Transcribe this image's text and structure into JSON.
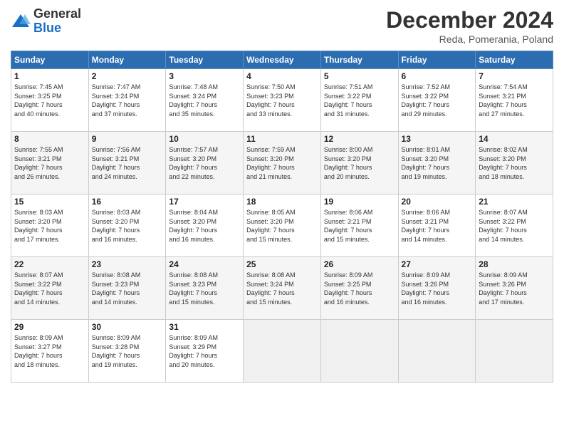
{
  "header": {
    "logo_general": "General",
    "logo_blue": "Blue",
    "month_title": "December 2024",
    "location": "Reda, Pomerania, Poland"
  },
  "weekdays": [
    "Sunday",
    "Monday",
    "Tuesday",
    "Wednesday",
    "Thursday",
    "Friday",
    "Saturday"
  ],
  "weeks": [
    [
      {
        "day": "1",
        "info": "Sunrise: 7:45 AM\nSunset: 3:25 PM\nDaylight: 7 hours\nand 40 minutes."
      },
      {
        "day": "2",
        "info": "Sunrise: 7:47 AM\nSunset: 3:24 PM\nDaylight: 7 hours\nand 37 minutes."
      },
      {
        "day": "3",
        "info": "Sunrise: 7:48 AM\nSunset: 3:24 PM\nDaylight: 7 hours\nand 35 minutes."
      },
      {
        "day": "4",
        "info": "Sunrise: 7:50 AM\nSunset: 3:23 PM\nDaylight: 7 hours\nand 33 minutes."
      },
      {
        "day": "5",
        "info": "Sunrise: 7:51 AM\nSunset: 3:22 PM\nDaylight: 7 hours\nand 31 minutes."
      },
      {
        "day": "6",
        "info": "Sunrise: 7:52 AM\nSunset: 3:22 PM\nDaylight: 7 hours\nand 29 minutes."
      },
      {
        "day": "7",
        "info": "Sunrise: 7:54 AM\nSunset: 3:21 PM\nDaylight: 7 hours\nand 27 minutes."
      }
    ],
    [
      {
        "day": "8",
        "info": "Sunrise: 7:55 AM\nSunset: 3:21 PM\nDaylight: 7 hours\nand 26 minutes."
      },
      {
        "day": "9",
        "info": "Sunrise: 7:56 AM\nSunset: 3:21 PM\nDaylight: 7 hours\nand 24 minutes."
      },
      {
        "day": "10",
        "info": "Sunrise: 7:57 AM\nSunset: 3:20 PM\nDaylight: 7 hours\nand 22 minutes."
      },
      {
        "day": "11",
        "info": "Sunrise: 7:59 AM\nSunset: 3:20 PM\nDaylight: 7 hours\nand 21 minutes."
      },
      {
        "day": "12",
        "info": "Sunrise: 8:00 AM\nSunset: 3:20 PM\nDaylight: 7 hours\nand 20 minutes."
      },
      {
        "day": "13",
        "info": "Sunrise: 8:01 AM\nSunset: 3:20 PM\nDaylight: 7 hours\nand 19 minutes."
      },
      {
        "day": "14",
        "info": "Sunrise: 8:02 AM\nSunset: 3:20 PM\nDaylight: 7 hours\nand 18 minutes."
      }
    ],
    [
      {
        "day": "15",
        "info": "Sunrise: 8:03 AM\nSunset: 3:20 PM\nDaylight: 7 hours\nand 17 minutes."
      },
      {
        "day": "16",
        "info": "Sunrise: 8:03 AM\nSunset: 3:20 PM\nDaylight: 7 hours\nand 16 minutes."
      },
      {
        "day": "17",
        "info": "Sunrise: 8:04 AM\nSunset: 3:20 PM\nDaylight: 7 hours\nand 16 minutes."
      },
      {
        "day": "18",
        "info": "Sunrise: 8:05 AM\nSunset: 3:20 PM\nDaylight: 7 hours\nand 15 minutes."
      },
      {
        "day": "19",
        "info": "Sunrise: 8:06 AM\nSunset: 3:21 PM\nDaylight: 7 hours\nand 15 minutes."
      },
      {
        "day": "20",
        "info": "Sunrise: 8:06 AM\nSunset: 3:21 PM\nDaylight: 7 hours\nand 14 minutes."
      },
      {
        "day": "21",
        "info": "Sunrise: 8:07 AM\nSunset: 3:22 PM\nDaylight: 7 hours\nand 14 minutes."
      }
    ],
    [
      {
        "day": "22",
        "info": "Sunrise: 8:07 AM\nSunset: 3:22 PM\nDaylight: 7 hours\nand 14 minutes."
      },
      {
        "day": "23",
        "info": "Sunrise: 8:08 AM\nSunset: 3:23 PM\nDaylight: 7 hours\nand 14 minutes."
      },
      {
        "day": "24",
        "info": "Sunrise: 8:08 AM\nSunset: 3:23 PM\nDaylight: 7 hours\nand 15 minutes."
      },
      {
        "day": "25",
        "info": "Sunrise: 8:08 AM\nSunset: 3:24 PM\nDaylight: 7 hours\nand 15 minutes."
      },
      {
        "day": "26",
        "info": "Sunrise: 8:09 AM\nSunset: 3:25 PM\nDaylight: 7 hours\nand 16 minutes."
      },
      {
        "day": "27",
        "info": "Sunrise: 8:09 AM\nSunset: 3:26 PM\nDaylight: 7 hours\nand 16 minutes."
      },
      {
        "day": "28",
        "info": "Sunrise: 8:09 AM\nSunset: 3:26 PM\nDaylight: 7 hours\nand 17 minutes."
      }
    ],
    [
      {
        "day": "29",
        "info": "Sunrise: 8:09 AM\nSunset: 3:27 PM\nDaylight: 7 hours\nand 18 minutes."
      },
      {
        "day": "30",
        "info": "Sunrise: 8:09 AM\nSunset: 3:28 PM\nDaylight: 7 hours\nand 19 minutes."
      },
      {
        "day": "31",
        "info": "Sunrise: 8:09 AM\nSunset: 3:29 PM\nDaylight: 7 hours\nand 20 minutes."
      },
      {
        "day": "",
        "info": ""
      },
      {
        "day": "",
        "info": ""
      },
      {
        "day": "",
        "info": ""
      },
      {
        "day": "",
        "info": ""
      }
    ]
  ]
}
